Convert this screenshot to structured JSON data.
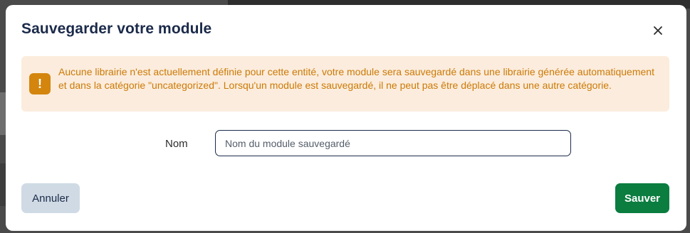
{
  "dialog": {
    "title": "Sauvegarder votre module",
    "close_icon": "close-icon"
  },
  "alert": {
    "icon": "!",
    "icon_name": "warning-icon",
    "message": "Aucune librairie n'est actuellement définie pour cette entité, votre module sera sauvegardé dans une librairie générée automatiquement et dans la catégorie \"uncategorized\". Lorsqu'un module est sauvegardé, il ne peut pas être déplacé dans une autre catégorie.",
    "text_color": "#cc7a06",
    "background": "#fbecdd",
    "icon_color": "#d4850d"
  },
  "form": {
    "name_label": "Nom",
    "name_value": "",
    "name_placeholder": "Nom du module sauvegardé"
  },
  "actions": {
    "cancel_label": "Annuler",
    "save_label": "Sauver",
    "save_color": "#0a7d3f",
    "cancel_color": "#cfdae4"
  }
}
